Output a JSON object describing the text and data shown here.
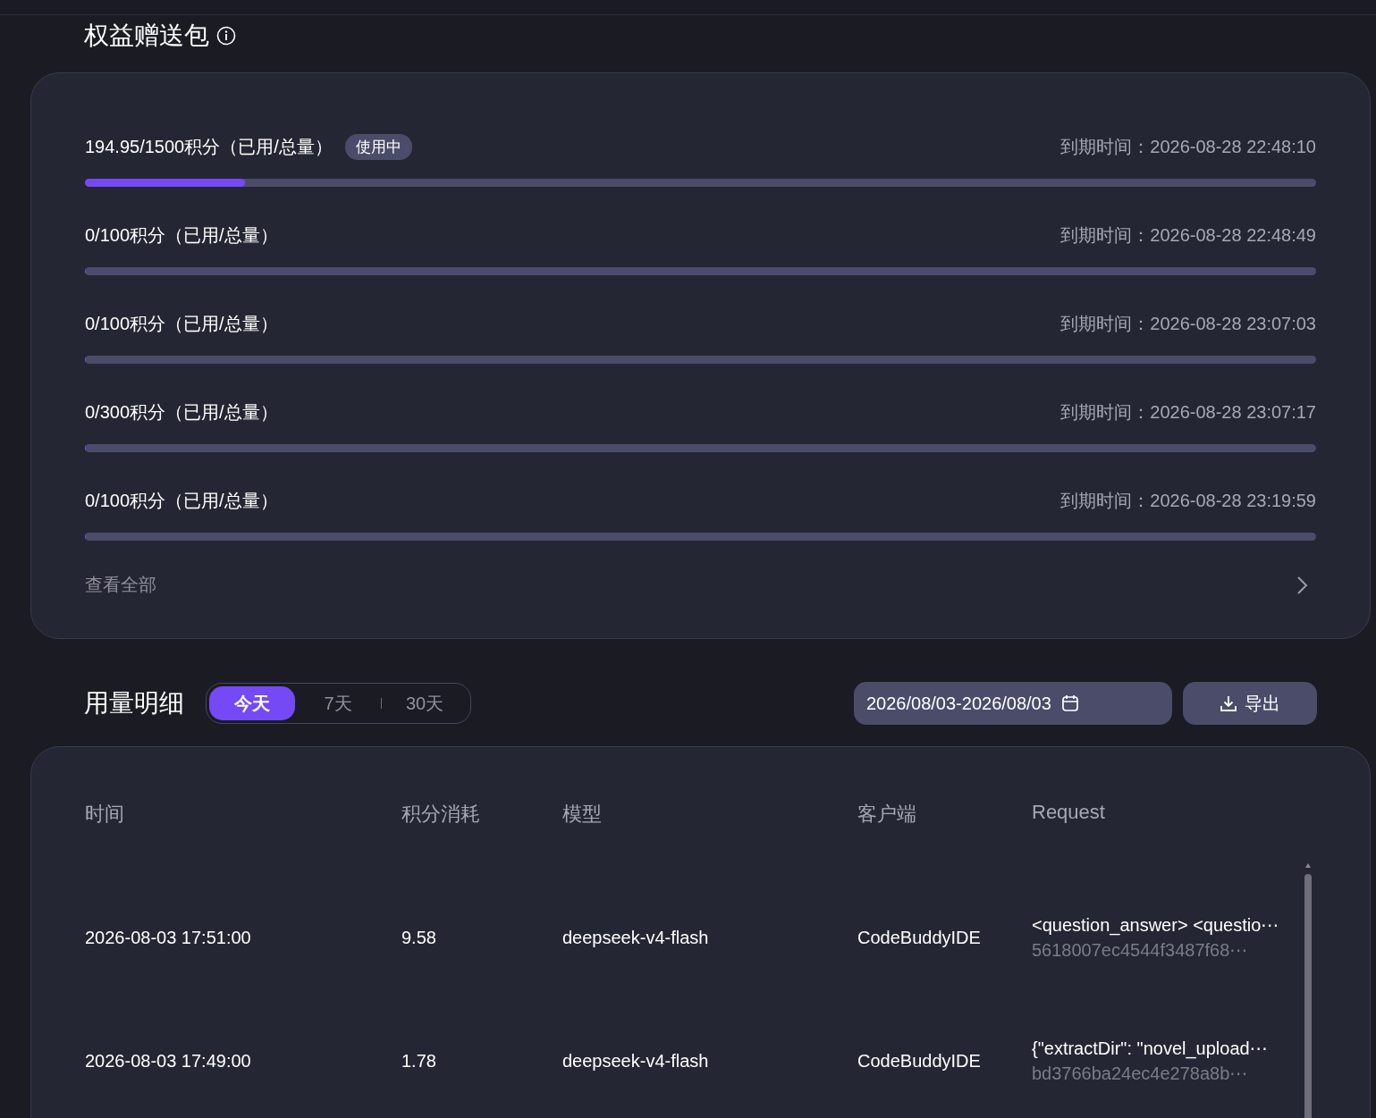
{
  "gift_section": {
    "title": "权益赠送包",
    "packages": [
      {
        "usage": "194.95/1500积分（已用/总量）",
        "badge": "使用中",
        "expiry": "到期时间：2026-08-28 22:48:10",
        "level": 0.13
      },
      {
        "usage": "0/100积分（已用/总量）",
        "expiry": "到期时间：2026-08-28 22:48:49",
        "level": 0
      },
      {
        "usage": "0/100积分（已用/总量）",
        "expiry": "到期时间：2026-08-28 23:07:03",
        "level": 0
      },
      {
        "usage": "0/300积分（已用/总量）",
        "expiry": "到期时间：2026-08-28 23:07:17",
        "level": 0
      },
      {
        "usage": "0/100积分（已用/总量）",
        "expiry": "到期时间：2026-08-28 23:19:59",
        "level": 0
      }
    ],
    "view_all": "查看全部"
  },
  "usage_section": {
    "title": "用量明细",
    "ranges": [
      {
        "label": "今天",
        "selected": true
      },
      {
        "label": "7天",
        "selected": false
      },
      {
        "label": "30天",
        "selected": false
      }
    ],
    "date_range": "2026/08/03-2026/08/03",
    "export_button": "导出",
    "table": {
      "columns": [
        "时间",
        "积分消耗",
        "模型",
        "客户端",
        "Request"
      ],
      "rows": [
        {
          "time": "2026-08-03 17:51:00",
          "credits": "9.58",
          "model": "deepseek-v4-flash",
          "client": "CodeBuddyIDE",
          "request": "<question_answer> <questio⋯",
          "request_id": "5618007ec4544f3487f68⋯"
        },
        {
          "time": "2026-08-03 17:49:00",
          "credits": "1.78",
          "model": "deepseek-v4-flash",
          "client": "CodeBuddyIDE",
          "request": "{\"extractDir\": \"novel_upload⋯",
          "request_id": "bd3766ba24ec4e278a8b⋯"
        }
      ]
    }
  }
}
